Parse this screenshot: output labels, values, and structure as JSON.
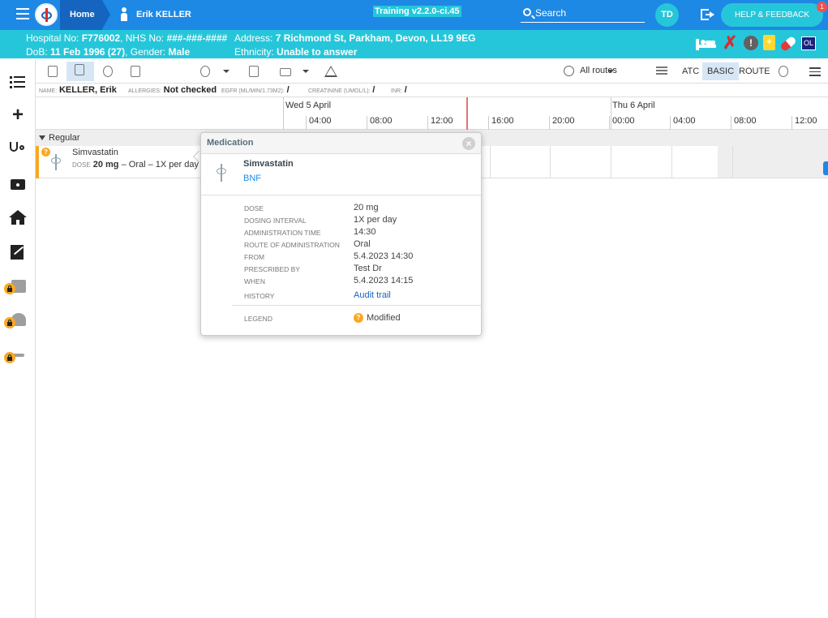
{
  "topbar": {
    "home": "Home",
    "patient": "Erik KELLER",
    "version": "Training v2.2.0-ci.45",
    "search": "Search",
    "user_initials": "TD",
    "help": "HELP & FEEDBACK",
    "help_badge": "1",
    "colors": {
      "bar": "#1e88e5",
      "accent": "#26c6da"
    }
  },
  "patient": {
    "hospital_label": "Hospital No:",
    "hospital_no": "F776002",
    "nhs_label": "NHS No:",
    "nhs_no": "###-###-####",
    "dob_label": "DoB:",
    "dob": "11 Feb 1996 (27)",
    "gender_label": "Gender:",
    "gender": "Male",
    "address_label": "Address:",
    "address": "7 Richmond St, Parkham, Devon, LL19 9EG",
    "ethnicity_label": "Ethnicity:",
    "ethnicity": "Unable to answer",
    "icons": [
      "bed-icon",
      "x-icon",
      "alert-icon",
      "clipboard-icon",
      "pill-icon",
      "ol-icon"
    ],
    "ol": "OL",
    "clip_plus": "+",
    "excl": "!"
  },
  "sidebar": {
    "icons": [
      "list-icon",
      "plus-icon",
      "stethoscope-icon",
      "camera-icon",
      "home-icon",
      "chart-edit-icon",
      "locked-clipboard-icon",
      "locked-walk-icon",
      "locked-plus-icon"
    ],
    "plus": "+"
  },
  "toolbar": {
    "routes": "All routes",
    "atc": "ATC",
    "basic": "BASIC",
    "route": "ROUTE"
  },
  "info": {
    "name_label": "NAME:",
    "name": "KELLER, Erik",
    "allergies_label": "ALLERGIES:",
    "allergies": "Not checked",
    "egfr_label": "EGFR (ML/MIN/1.73M2):",
    "egfr": "/",
    "creat_label": "CREATININE (UMOL/L):",
    "creat": "/",
    "inr_label": "INR:",
    "inr": "/"
  },
  "timeline": {
    "day1": "Wed 5 April",
    "day2": "Thu 6 April",
    "times": [
      "04:00",
      "08:00",
      "12:00",
      "16:00",
      "20:00",
      "00:00",
      "04:00",
      "08:00",
      "12:00"
    ]
  },
  "group": {
    "label": "Regular"
  },
  "med": {
    "name": "Simvastatin",
    "dose_label": "DOSE",
    "dose": "20 mg",
    "detail": "– Oral – 1X per day",
    "badge": "?"
  },
  "popup": {
    "title": "Medication",
    "close": "×",
    "name": "Simvastatin",
    "source": "BNF",
    "rows": [
      {
        "label": "DOSE",
        "value": "20 mg"
      },
      {
        "label": "DOSING INTERVAL",
        "value": "1X per day"
      },
      {
        "label": "ADMINISTRATION TIME",
        "value": "14:30"
      },
      {
        "label": "ROUTE OF ADMINISTRATION",
        "value": "Oral"
      },
      {
        "label": "FROM",
        "value": "5.4.2023 14:30"
      },
      {
        "label": "PRESCRIBED BY",
        "value": "Test Dr"
      },
      {
        "label": "WHEN",
        "value": "5.4.2023 14:15"
      },
      {
        "label": "HISTORY",
        "value": "Audit trail"
      }
    ],
    "legend_label": "LEGEND",
    "legend_badge": "?",
    "legend_value": "Modified"
  }
}
